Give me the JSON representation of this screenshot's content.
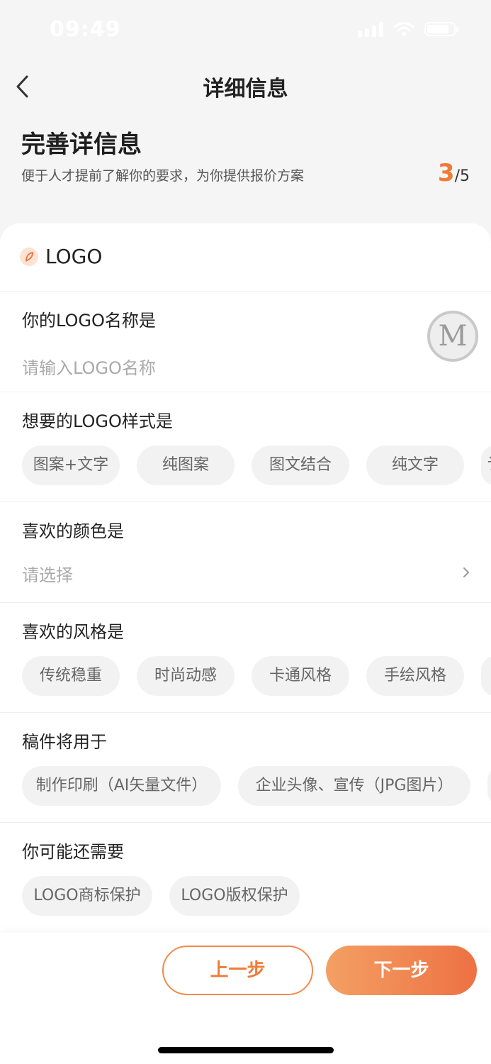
{
  "status": {
    "time": "09:49"
  },
  "nav": {
    "title": "详细信息"
  },
  "intro": {
    "title": "完善详信息",
    "subtitle": "便于人才提前了解你的要求，为你提供报价方案",
    "step_current": "3",
    "step_total": "/5"
  },
  "section": {
    "title": "LOGO"
  },
  "questions": {
    "name": {
      "label": "你的LOGO名称是",
      "placeholder": "请输入LOGO名称"
    },
    "style": {
      "label": "想要的LOGO样式是",
      "options": [
        "图案+文字",
        "纯图案",
        "图文结合",
        "纯文字",
        "讠"
      ]
    },
    "color": {
      "label": "喜欢的颜色是",
      "value": "请选择"
    },
    "vibe": {
      "label": "喜欢的风格是",
      "options": [
        "传统稳重",
        "时尚动感",
        "卡通风格",
        "手绘风格"
      ]
    },
    "usage": {
      "label": "稿件将用于",
      "options": [
        "制作印刷（AI矢量文件）",
        "企业头像、宣传（JPG图片）"
      ]
    },
    "extras": {
      "label": "你可能还需要",
      "options": [
        "LOGO商标保护",
        "LOGO版权保护"
      ]
    }
  },
  "floating_avatar": {
    "letter": "M"
  },
  "buttons": {
    "prev": "上一步",
    "next": "下一步"
  },
  "colors": {
    "accent": "#f07b38",
    "accent_gradient_start": "#f3a063",
    "accent_gradient_end": "#ee7143"
  }
}
